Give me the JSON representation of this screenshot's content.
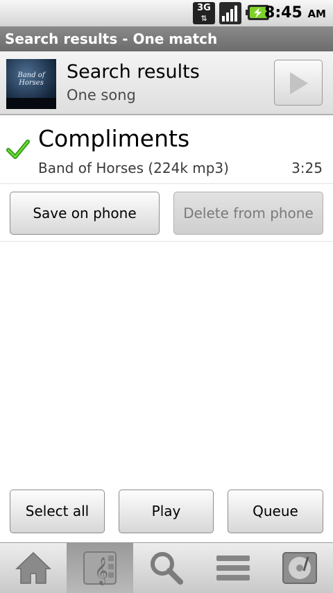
{
  "status_bar": {
    "network": "3G",
    "time": "8:45",
    "ampm": "AM",
    "icons": [
      "3g-data-icon",
      "signal-strength-icon",
      "battery-charging-icon"
    ]
  },
  "title_bar": {
    "title": "Search results - One match"
  },
  "header": {
    "album_art_text": "Band of Horses",
    "title": "Search results",
    "subtitle": "One song",
    "play_icon": "play-icon"
  },
  "song": {
    "title": "Compliments",
    "meta": "Band of Horses (224k mp3)",
    "duration": "3:25",
    "checked": true
  },
  "actions": {
    "save_label": "Save on phone",
    "delete_label": "Delete from phone"
  },
  "bottom_actions": {
    "select_all_label": "Select all",
    "play_label": "Play",
    "queue_label": "Queue"
  },
  "tabs": [
    {
      "icon": "home-icon",
      "active": false
    },
    {
      "icon": "music-library-icon",
      "active": true
    },
    {
      "icon": "search-icon",
      "active": false
    },
    {
      "icon": "list-icon",
      "active": false
    },
    {
      "icon": "now-playing-icon",
      "active": false
    }
  ]
}
